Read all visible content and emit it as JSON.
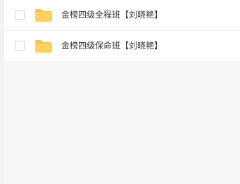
{
  "files": [
    {
      "name": "金榜四级全程班【刘晓艳】",
      "icon": "folder-icon"
    },
    {
      "name": "金榜四级保命班【刘晓艳】",
      "icon": "folder-icon"
    }
  ],
  "colors": {
    "folder": "#ffd15c",
    "folder_tab": "#f6c24a",
    "text": "#333333"
  }
}
